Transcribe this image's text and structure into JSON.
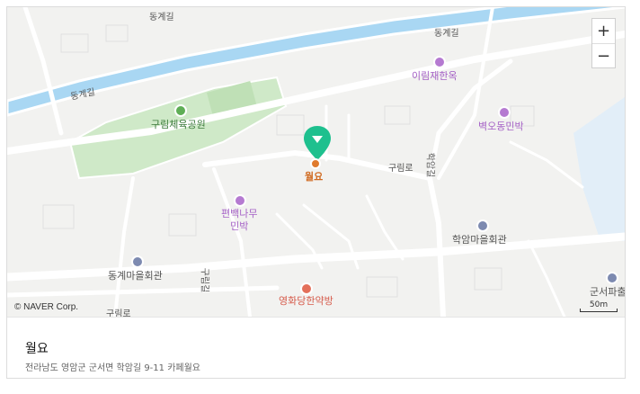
{
  "map": {
    "labels": {
      "donggye_top": "동계길",
      "donggye_left": "동계길",
      "donggye_right": "동계길",
      "guryim_road": "구림로",
      "guryim_road_bottom": "구림로",
      "guryim_gil_v": "구림길",
      "hakam_gil_v": "학암길"
    },
    "pois": {
      "stadium": "구림체육공원",
      "irimjae": "이림재한옥",
      "byeokodong": "벽오동민박",
      "wolyo": "월요",
      "pyeonbaek_line1": "편백나무",
      "pyeonbaek_line2": "민박",
      "donggye_hall": "동계마을회관",
      "hakam_hall": "학암마을회관",
      "yeonghwadang": "영화당한약방",
      "police": "군서파출"
    },
    "copyright": "© NAVER Corp.",
    "scale": "50m",
    "zoom_in": "+",
    "zoom_out": "−",
    "colors": {
      "river": "#a8d8f5",
      "park": "#c8e6c0",
      "road": "#ffffff",
      "water_pond": "#dfeaf6",
      "marker": "#1ec08e"
    }
  },
  "place": {
    "name": "월요",
    "address": "전라남도 영암군 군서면 학암길 9-11 카페월요"
  }
}
